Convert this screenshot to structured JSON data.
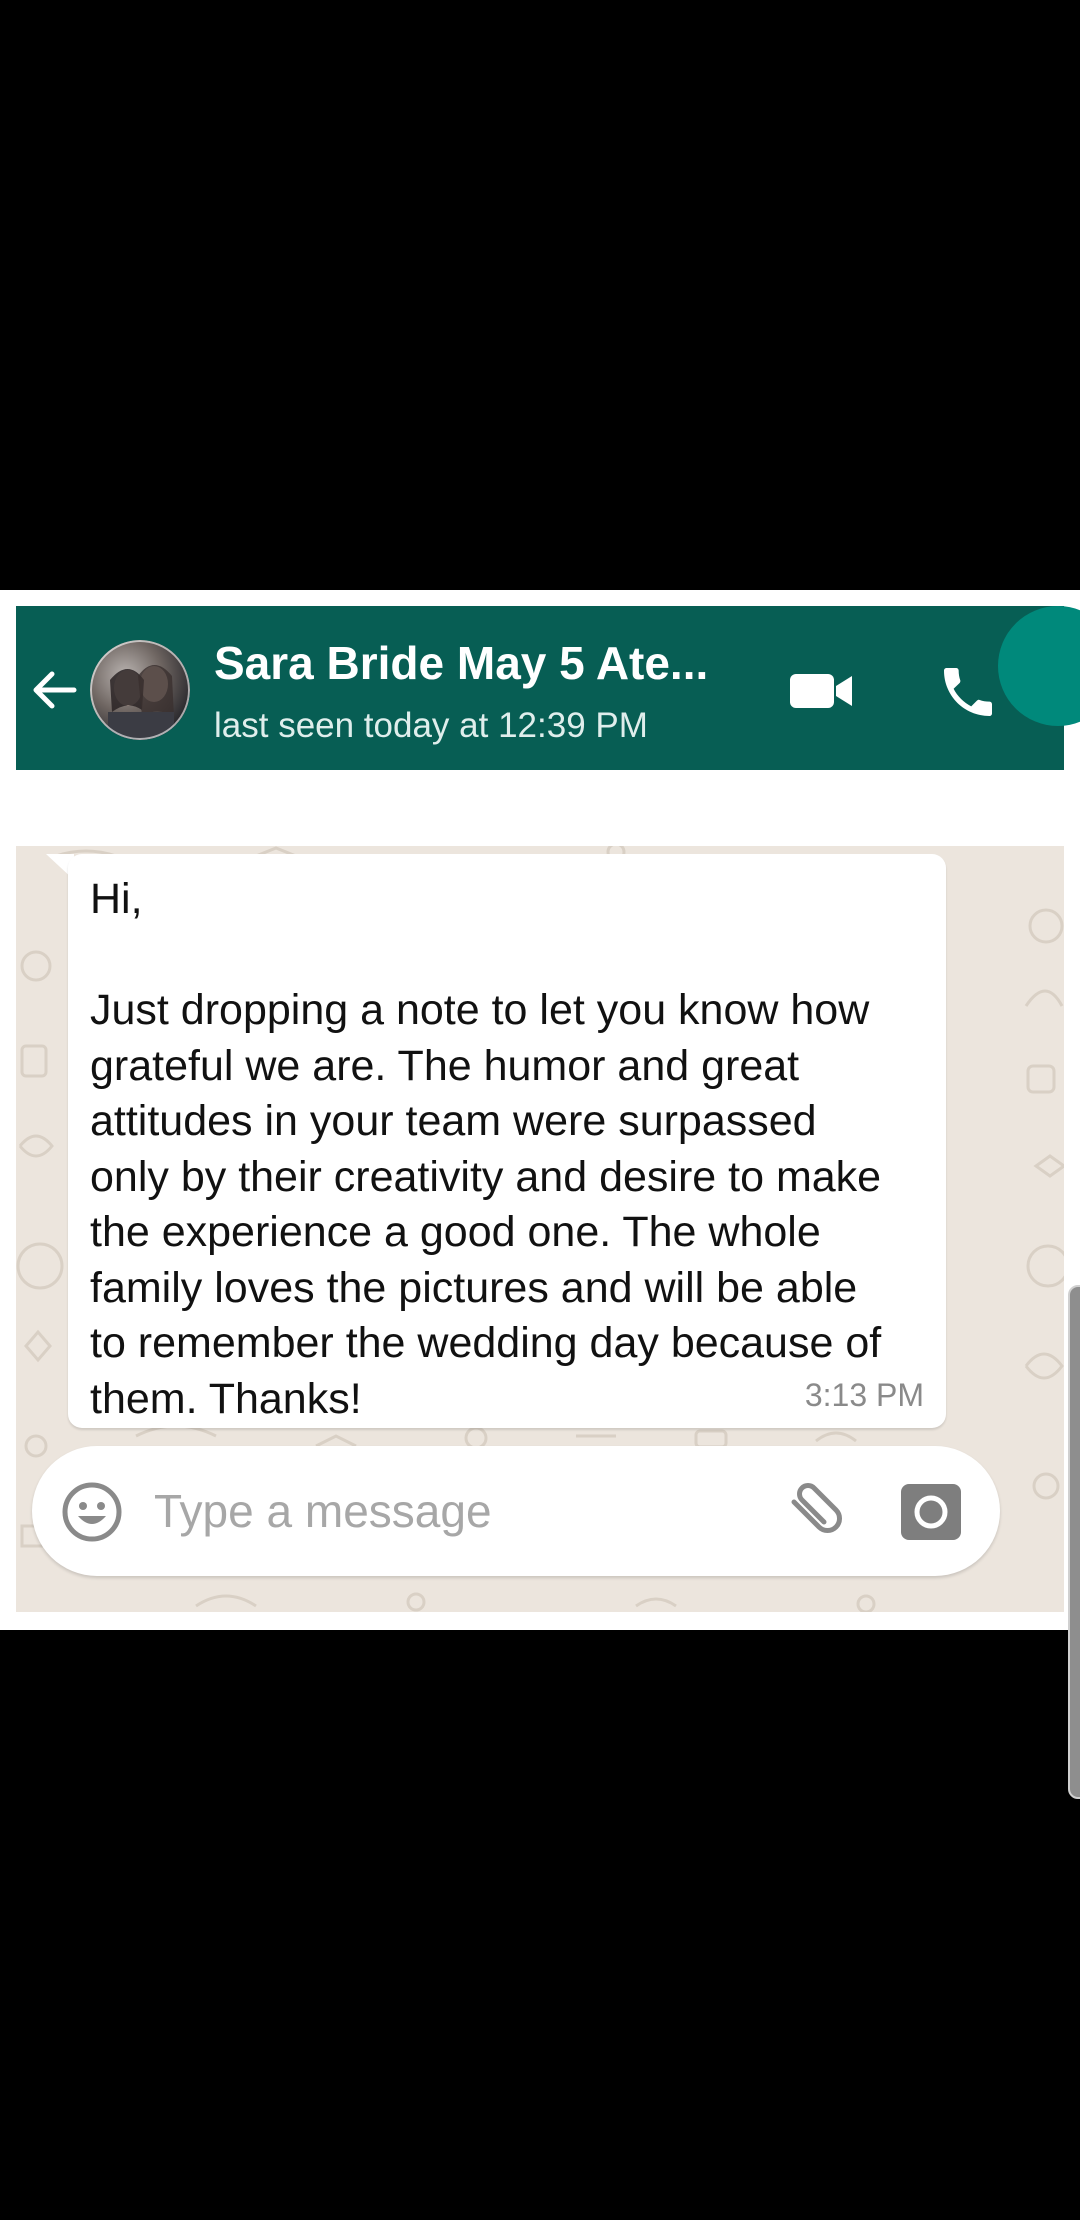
{
  "header": {
    "contact_name": "Sara Bride May 5 Ate...",
    "last_seen": "last seen today at 12:39 PM",
    "back_icon": "arrow-left-icon",
    "video_icon": "video-camera-icon",
    "call_icon": "phone-icon",
    "color": "#075e54"
  },
  "chat": {
    "background_color": "#ece5dd",
    "messages": [
      {
        "text": "Hi,\n\nJust dropping a note to let you know how\ngrateful we are. The humor and great\nattitudes in your team were surpassed\nonly by their creativity and desire to make\nthe experience a good one. The whole\nfamily loves the pictures and will be able\nto remember the wedding day because of\nthem. Thanks!",
        "time": "3:13 PM",
        "direction": "incoming"
      }
    ]
  },
  "composer": {
    "placeholder": "Type a message",
    "emoji_icon": "emoji-icon",
    "attach_icon": "paperclip-icon",
    "camera_icon": "camera-icon",
    "send_color": "#00897b"
  }
}
